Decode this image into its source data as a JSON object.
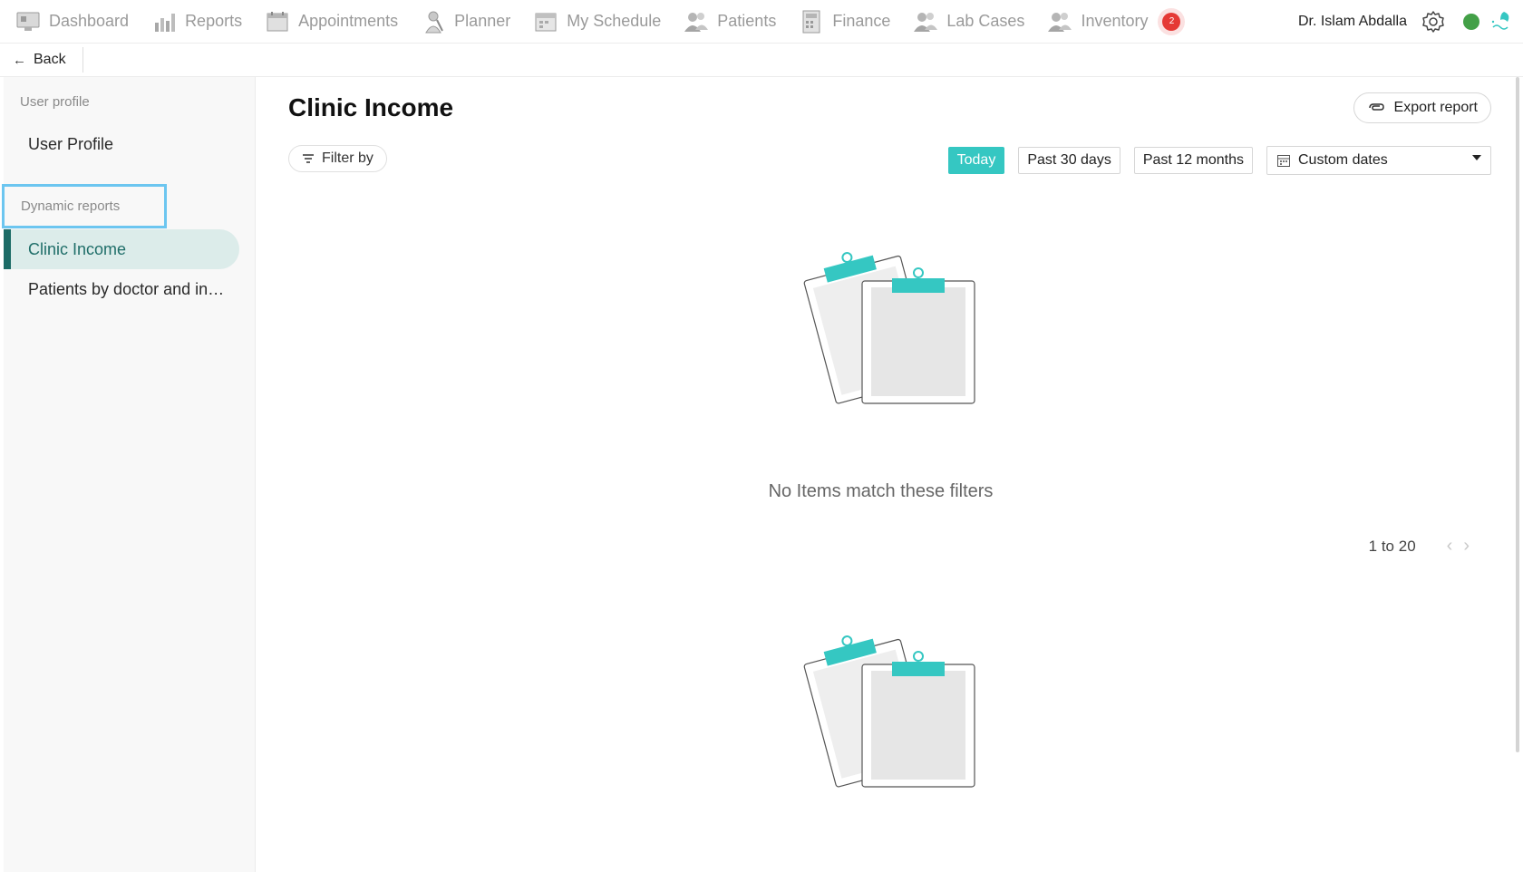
{
  "topnav": {
    "items": [
      {
        "label": "Dashboard",
        "icon": "dashboard-icon"
      },
      {
        "label": "Reports",
        "icon": "reports-icon"
      },
      {
        "label": "Appointments",
        "icon": "appointments-icon"
      },
      {
        "label": "Planner",
        "icon": "planner-icon"
      },
      {
        "label": "My Schedule",
        "icon": "schedule-icon"
      },
      {
        "label": "Patients",
        "icon": "patients-icon"
      },
      {
        "label": "Finance",
        "icon": "finance-icon"
      },
      {
        "label": "Lab Cases",
        "icon": "lab-cases-icon"
      },
      {
        "label": "Inventory",
        "icon": "inventory-icon"
      }
    ],
    "inventory_badge": "2",
    "user_name": "Dr. Islam Abdalla",
    "status_color": "#43a047"
  },
  "backbar": {
    "back_label": "Back"
  },
  "sidebar": {
    "section_user": "User profile",
    "user_profile": "User Profile",
    "section_reports": "Dynamic reports",
    "items": [
      {
        "label": "Clinic Income",
        "active": true
      },
      {
        "label": "Patients by doctor and in…",
        "active": false
      }
    ]
  },
  "main": {
    "title": "Clinic Income",
    "export_label": "Export report",
    "filter_label": "Filter by",
    "ranges": [
      "Today",
      "Past 30 days",
      "Past 12 months"
    ],
    "active_range": "Today",
    "date_select": "Custom dates",
    "empty_text": "No Items match these filters",
    "pager_text": "1 to 20"
  },
  "colors": {
    "accent": "#35c7c2",
    "active_nav_bg": "#dcecea",
    "active_nav_text": "#1f6e69",
    "badge": "#e53935"
  }
}
